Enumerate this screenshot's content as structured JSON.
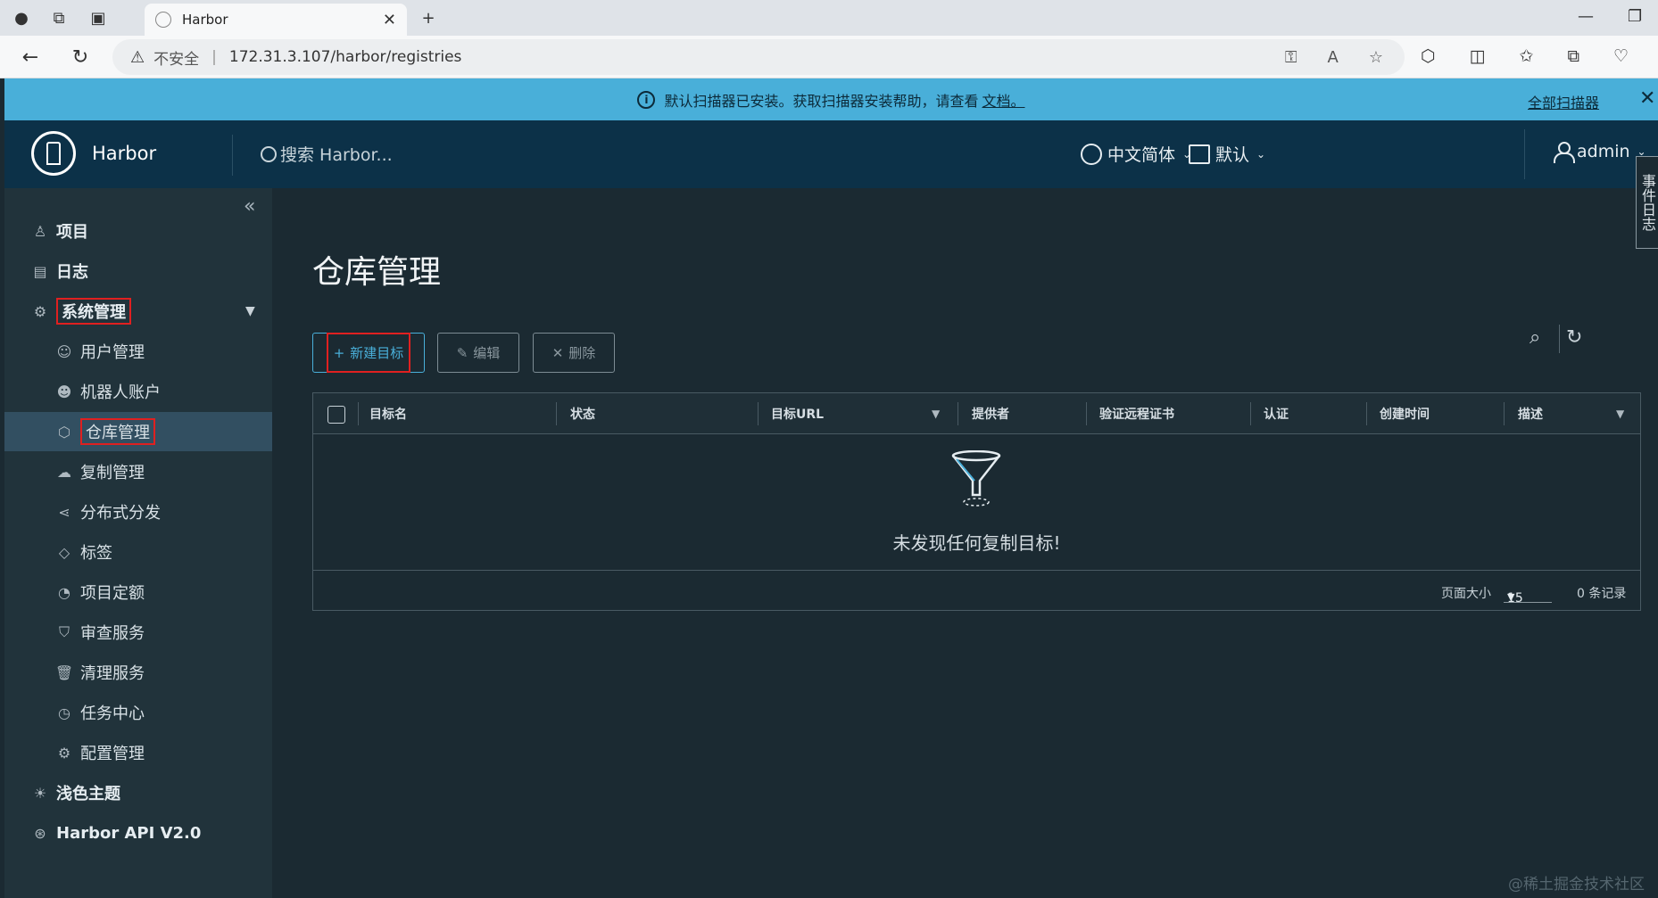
{
  "browser": {
    "tab_title": "Harbor",
    "security_label": "不安全",
    "url": "172.31.3.107/harbor/registries"
  },
  "banner": {
    "message": "默认扫描器已安装。获取扫描器安装帮助，请查看",
    "doc_link": "文档。",
    "all_scanners": "全部扫描器"
  },
  "header": {
    "brand": "Harbor",
    "search_placeholder": "搜索 Harbor...",
    "language": "中文简体",
    "date_format": "默认",
    "user": "admin",
    "event_log_tab": "事件日志"
  },
  "sidebar": {
    "items": [
      {
        "label": "项目",
        "icon": "projects-icon"
      },
      {
        "label": "日志",
        "icon": "logs-icon"
      },
      {
        "label": "系统管理",
        "icon": "admin-icon"
      },
      {
        "label": "用户管理",
        "icon": "users-icon"
      },
      {
        "label": "机器人账户",
        "icon": "robot-icon"
      },
      {
        "label": "仓库管理",
        "icon": "registry-icon"
      },
      {
        "label": "复制管理",
        "icon": "replication-icon"
      },
      {
        "label": "分布式分发",
        "icon": "distribution-icon"
      },
      {
        "label": "标签",
        "icon": "tag-icon"
      },
      {
        "label": "项目定额",
        "icon": "quota-icon"
      },
      {
        "label": "审查服务",
        "icon": "shield-icon"
      },
      {
        "label": "清理服务",
        "icon": "trash-icon"
      },
      {
        "label": "任务中心",
        "icon": "clock-icon"
      },
      {
        "label": "配置管理",
        "icon": "gear-icon"
      },
      {
        "label": "浅色主题",
        "icon": "sun-icon"
      },
      {
        "label": "Harbor API V2.0",
        "icon": "api-icon"
      }
    ]
  },
  "main": {
    "title": "仓库管理",
    "buttons": {
      "new": "新建目标",
      "edit": "编辑",
      "delete": "删除"
    },
    "columns": [
      "目标名",
      "状态",
      "目标URL",
      "提供者",
      "验证远程证书",
      "认证",
      "创建时间",
      "描述"
    ],
    "empty_message": "未发现任何复制目标!",
    "footer": {
      "page_size_label": "页面大小",
      "page_size": "15",
      "records": "0 条记录"
    }
  },
  "watermark": "@稀土掘金技术社区",
  "colors": {
    "banner": "#49afd9",
    "header": "#0c3148",
    "sidebar": "#21333b",
    "active_item": "#324f61",
    "main_bg": "#1b2a32",
    "highlight_box": "#e02020"
  }
}
